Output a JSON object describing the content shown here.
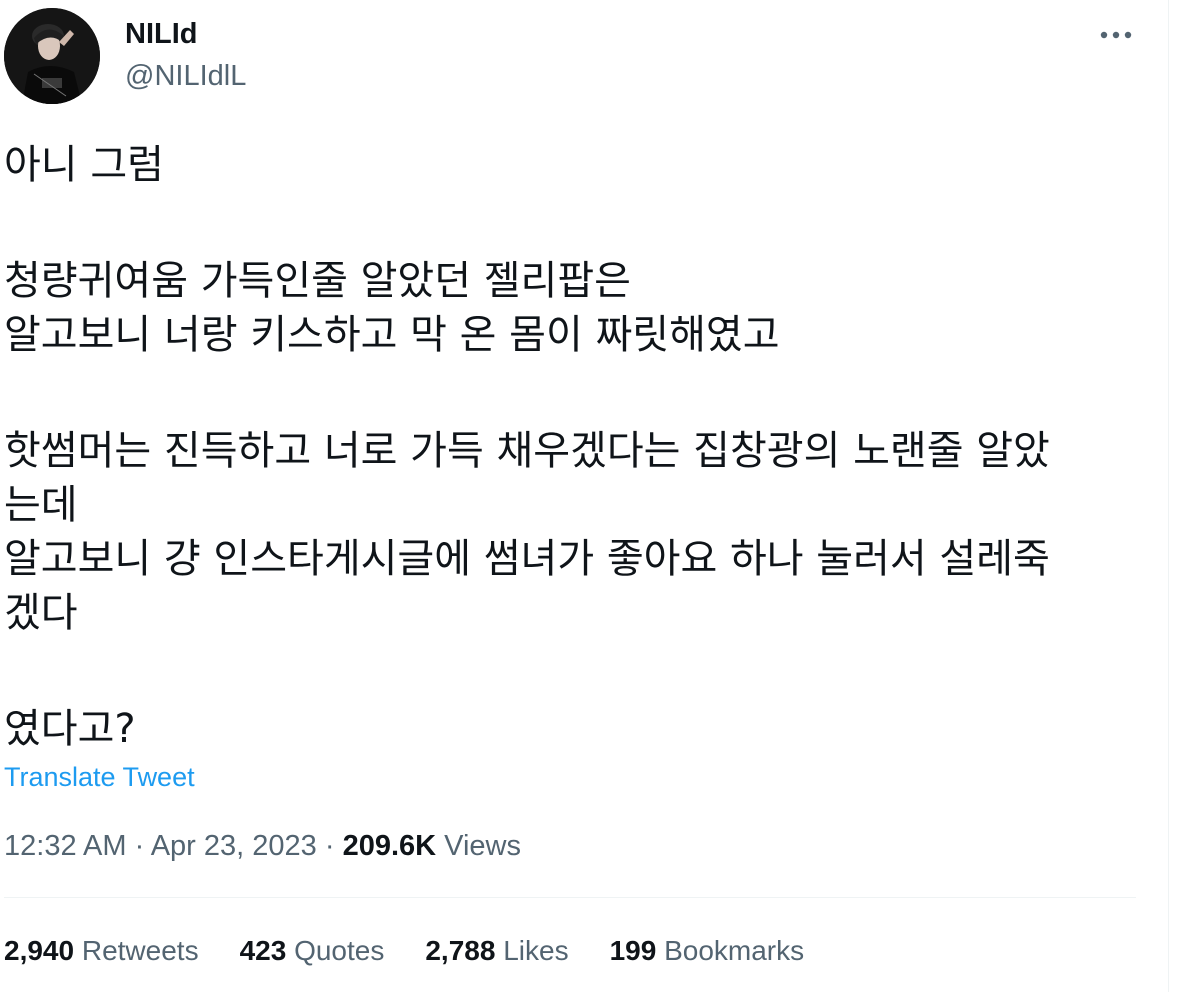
{
  "author": {
    "display_name": "NILId",
    "handle": "@NILIdlL",
    "avatar_icon": "profile-photo"
  },
  "tweet": {
    "lines": [
      "아니 그럼",
      "",
      "청량귀여움 가득인줄 알았던 젤리팝은",
      "알고보니 너랑 키스하고 막 온 몸이 짜릿해였고",
      "",
      "핫썸머는 진득하고 너로 가득 채우겠다는 집창광의 노랜줄 알았",
      "는데",
      "알고보니 걍 인스타게시글에 썸녀가 좋아요 하나 눌러서 설레죽",
      "겠다",
      "",
      "였다고?"
    ],
    "translate_label": "Translate Tweet"
  },
  "meta": {
    "time": "12:32 AM",
    "separator": " · ",
    "date": "Apr 23, 2023",
    "views_count": "209.6K",
    "views_label": " Views"
  },
  "stats": [
    {
      "count": "2,940",
      "label": " Retweets"
    },
    {
      "count": "423",
      "label": " Quotes"
    },
    {
      "count": "2,788",
      "label": " Likes"
    },
    {
      "count": "199",
      "label": " Bookmarks"
    }
  ],
  "colors": {
    "text": "#0f1419",
    "secondary": "#536471",
    "link": "#1d9bf0",
    "divider": "#eff3f4"
  },
  "icons": {
    "more": "more-horizontal-icon"
  }
}
